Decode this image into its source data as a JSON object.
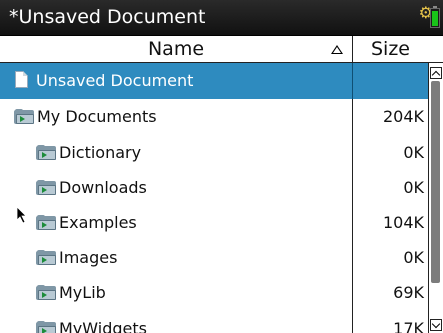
{
  "titlebar": {
    "title": "*Unsaved Document",
    "battery_icon": "battery-icon"
  },
  "columns": {
    "name": "Name",
    "size": "Size",
    "sort_icon": "sort-ascending-icon"
  },
  "rows": [
    {
      "name": "Unsaved Document",
      "size": "",
      "icon": "document-icon",
      "selected": true
    },
    {
      "name": "My Documents",
      "size": "204K",
      "icon": "folder-icon"
    },
    {
      "name": "Dictionary",
      "size": "0K",
      "icon": "folder-icon"
    },
    {
      "name": "Downloads",
      "size": "0K",
      "icon": "folder-icon"
    },
    {
      "name": "Examples",
      "size": "104K",
      "icon": "folder-icon"
    },
    {
      "name": "Images",
      "size": "0K",
      "icon": "folder-icon"
    },
    {
      "name": "MyLib",
      "size": "69K",
      "icon": "folder-icon"
    },
    {
      "name": "MyWidgets",
      "size": "17K",
      "icon": "folder-icon"
    }
  ],
  "colors": {
    "selection": "#2e8bbf",
    "titlebar": "#1a1a1a",
    "battery": "#19c419"
  }
}
